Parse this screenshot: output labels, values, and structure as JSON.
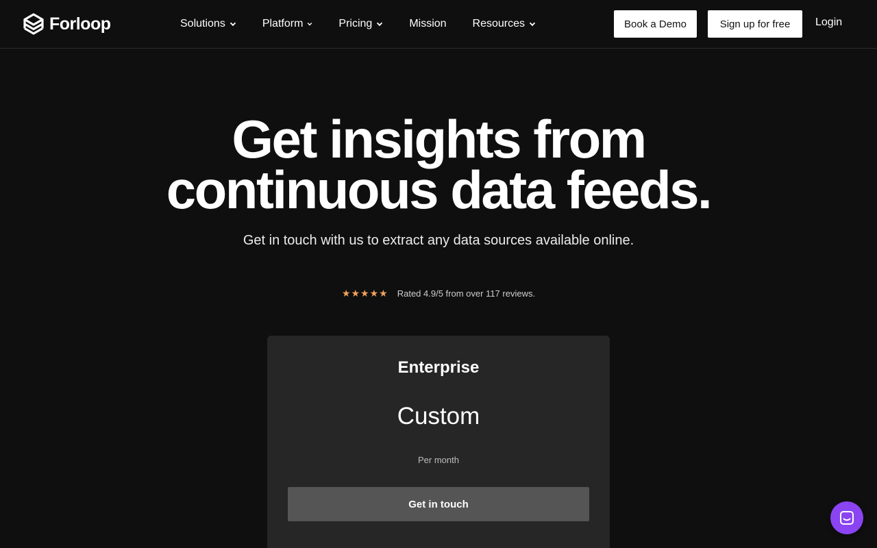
{
  "brand": {
    "name": "Forloop",
    "logo_icon": "forloop-logo-icon"
  },
  "nav": {
    "items": [
      {
        "label": "Solutions",
        "has_dropdown": true
      },
      {
        "label": "Platform",
        "has_dropdown": true
      },
      {
        "label": "Pricing",
        "has_dropdown": true
      },
      {
        "label": "Mission",
        "has_dropdown": false
      },
      {
        "label": "Resources",
        "has_dropdown": true
      }
    ],
    "book_demo_label": "Book a Demo",
    "signup_label": "Sign up for free",
    "login_label": "Login"
  },
  "hero": {
    "title_line1": "Get insights from",
    "title_line2": "continuous data feeds.",
    "subtitle": "Get in touch with us to extract any data sources available online.",
    "rating_stars": 5,
    "rating_text": "Rated 4.9/5 from over 117 reviews."
  },
  "pricing_card": {
    "plan": "Enterprise",
    "price": "Custom",
    "period": "Per month",
    "cta_label": "Get in touch"
  },
  "chat": {
    "icon": "chat-icon"
  },
  "colors": {
    "background": "#0f0f0f",
    "card": "#262626",
    "button_primary": "#ffffff",
    "card_button": "#555555",
    "star": "#f3a35c",
    "chat_launcher": "#8a44f2"
  }
}
